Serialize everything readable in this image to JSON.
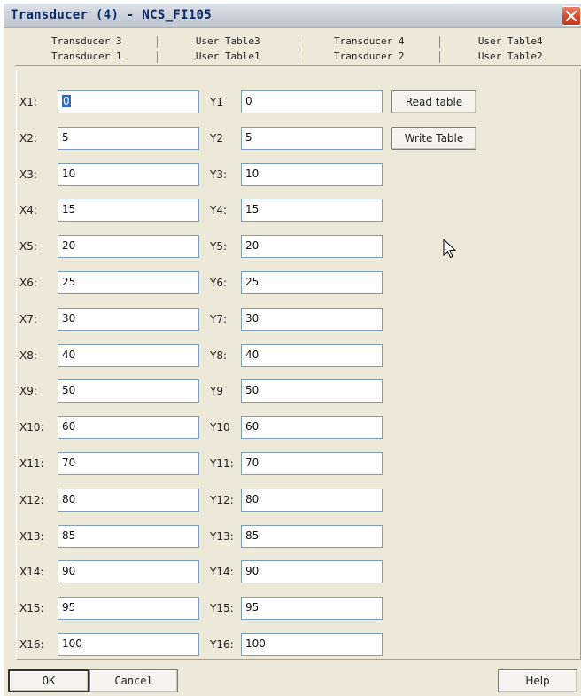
{
  "window": {
    "title": "Transducer (4) - NCS_FI105"
  },
  "tabs": {
    "back_row": [
      "Transducer 3",
      "User Table3",
      "Transducer 4",
      "User Table4"
    ],
    "front_row": [
      "Transducer 1",
      "User Table1",
      "Transducer 2",
      "User Table2"
    ],
    "active": "User Table1"
  },
  "table": {
    "x_labels": [
      "X1:",
      "X2:",
      "X3:",
      "X4:",
      "X5:",
      "X6:",
      "X7:",
      "X8:",
      "X9:",
      "X10:",
      "X11:",
      "X12:",
      "X13:",
      "X14:",
      "X15:",
      "X16:"
    ],
    "x_values": [
      "0",
      "5",
      "10",
      "15",
      "20",
      "25",
      "30",
      "40",
      "50",
      "60",
      "70",
      "80",
      "85",
      "90",
      "95",
      "100"
    ],
    "y_labels": [
      "Y1",
      "Y2",
      "Y3:",
      "Y4:",
      "Y5:",
      "Y6:",
      "Y7:",
      "Y8:",
      "Y9",
      "Y10",
      "Y11:",
      "Y12:",
      "Y13:",
      "Y14:",
      "Y15:",
      "Y16:"
    ],
    "y_values": [
      "0",
      "5",
      "10",
      "15",
      "20",
      "25",
      "30",
      "40",
      "50",
      "60",
      "70",
      "80",
      "85",
      "90",
      "95",
      "100"
    ]
  },
  "actions": {
    "read_label": "Read table",
    "write_label": "Write Table"
  },
  "footer": {
    "ok_label": "OK",
    "cancel_label": "Cancel",
    "help_label": "Help"
  },
  "colors": {
    "dialog_bg": "#ece9d8",
    "field_border": "#7f9db9",
    "selection": "#316ac5",
    "close_button": "#d4462a"
  }
}
